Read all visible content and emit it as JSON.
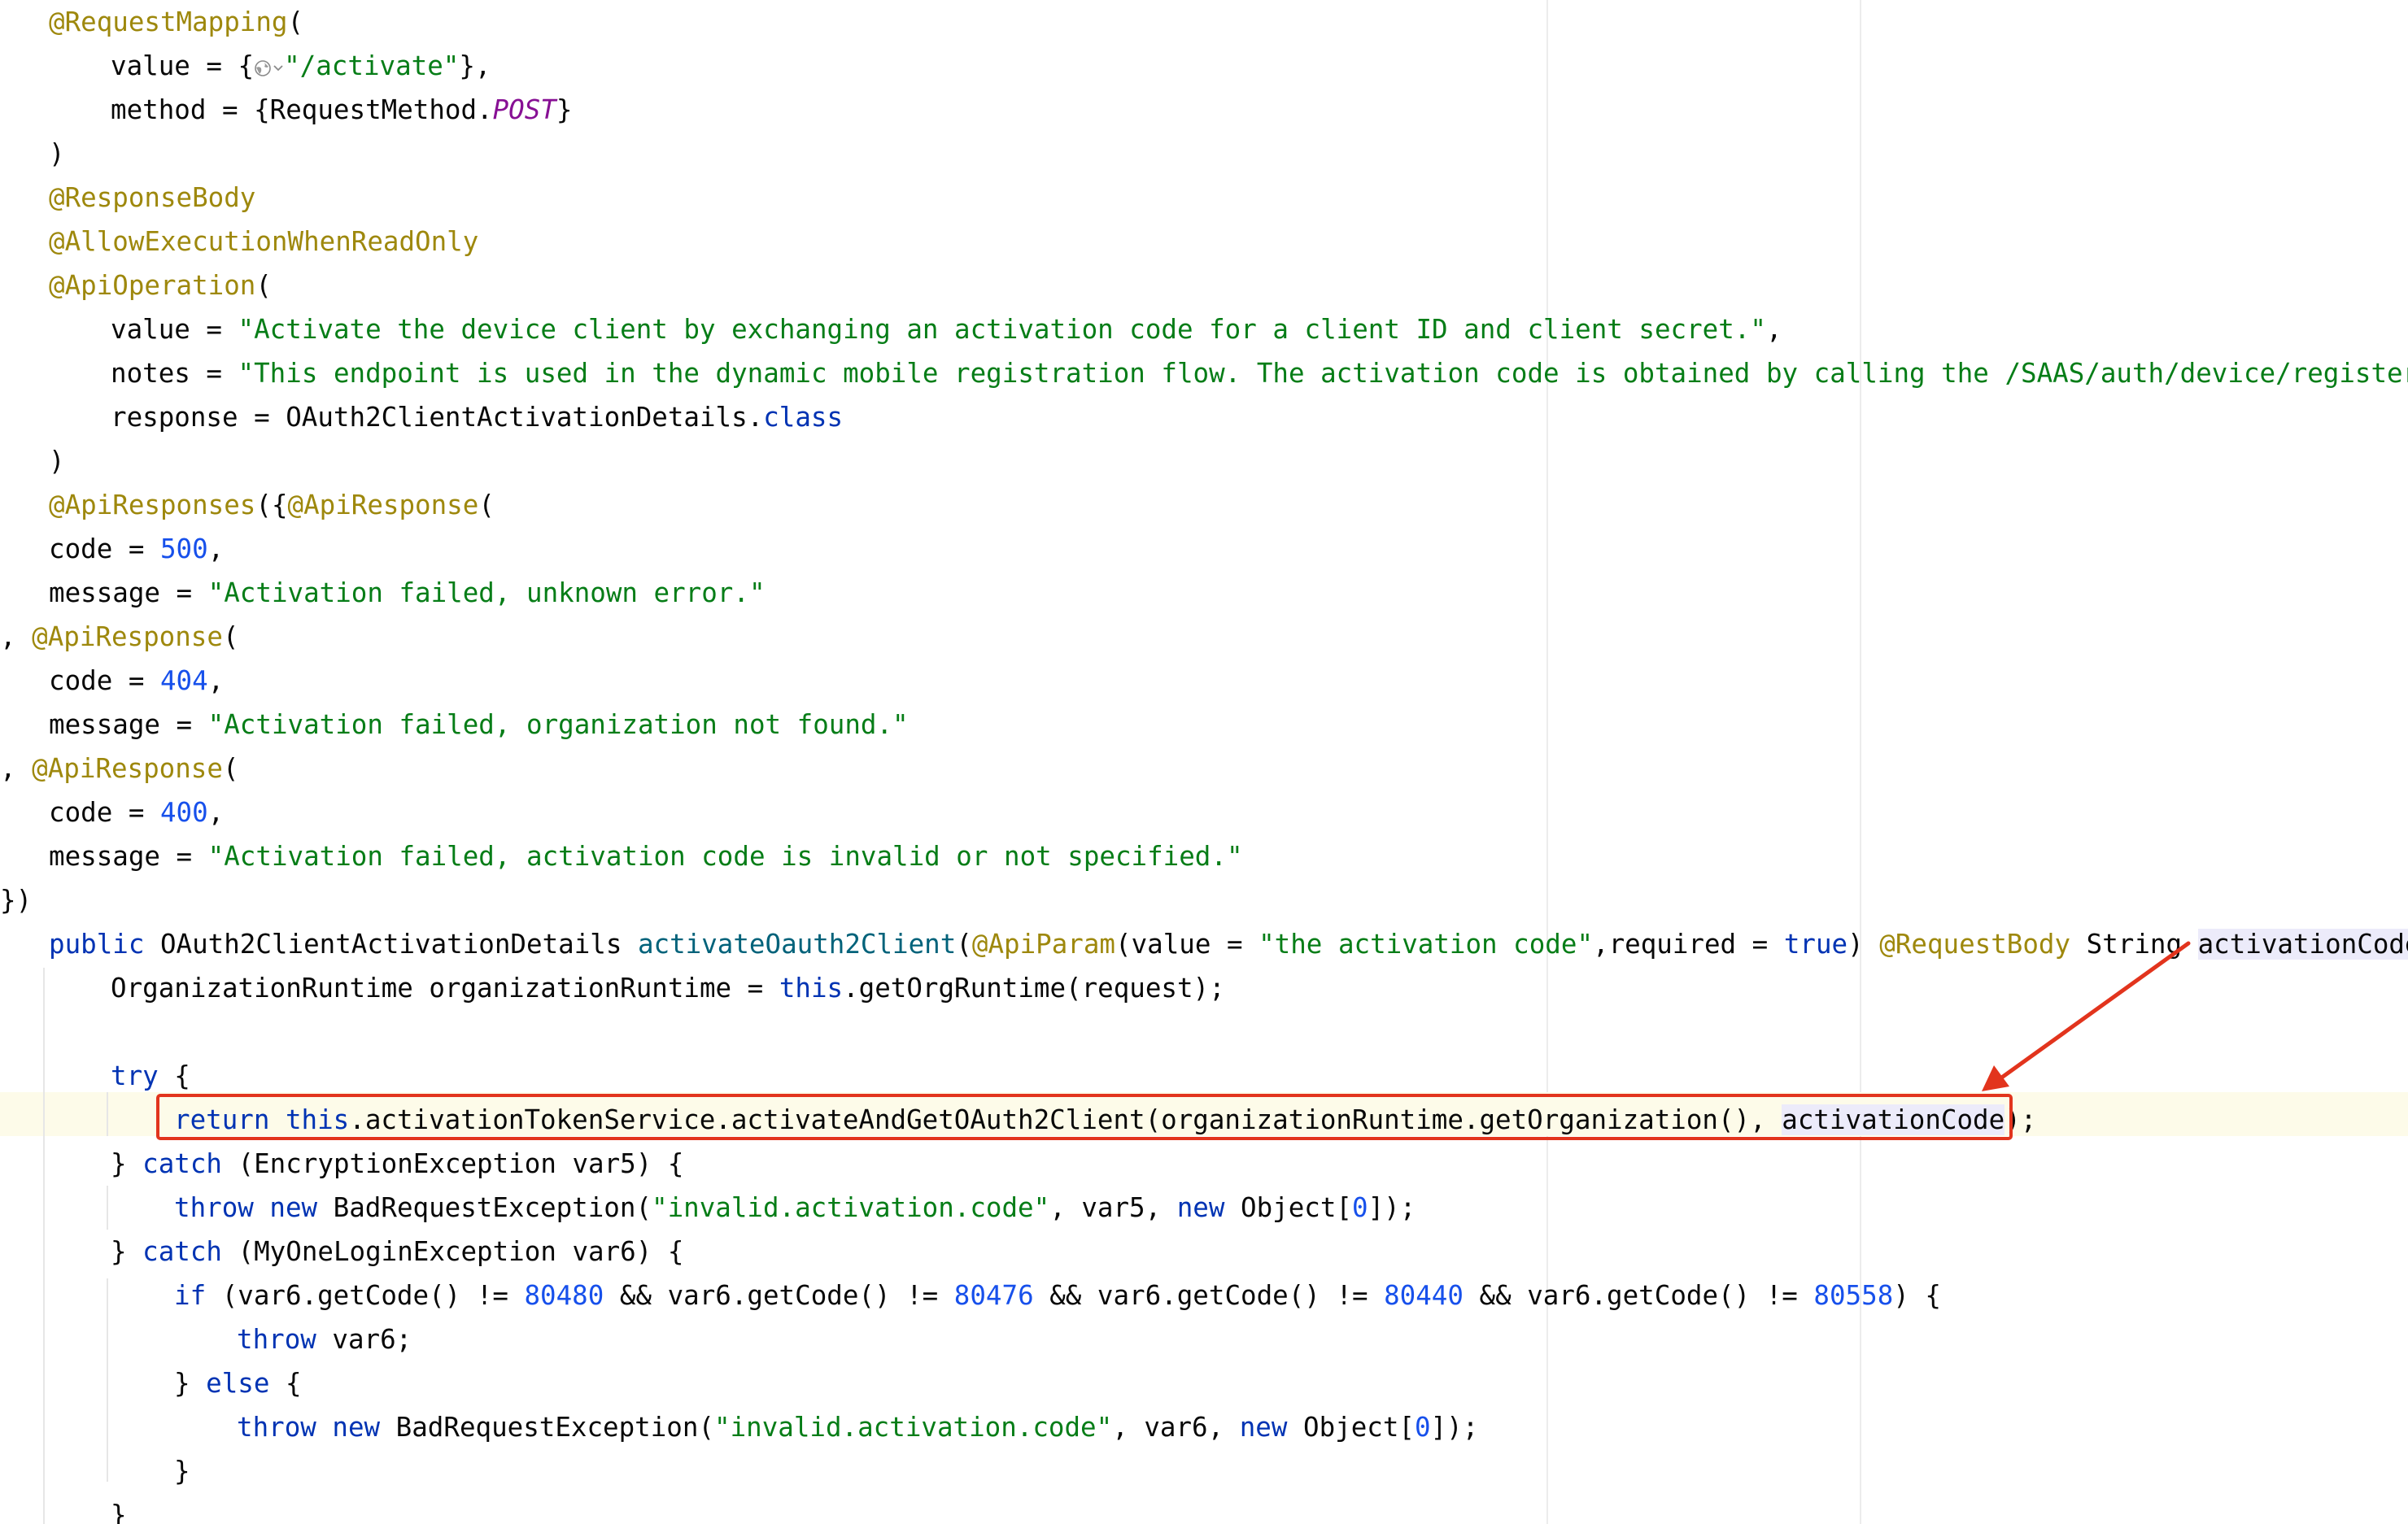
{
  "colors": {
    "annotation": "#9e880d",
    "string": "#067d17",
    "keyword": "#0033b3",
    "number": "#1750eb",
    "constant": "#871094",
    "method_declaration": "#00627a",
    "plain": "#080808",
    "highlight_box": "#e2341d",
    "arrow": "#e2341d",
    "identifier_usage_background": "#ecebfa",
    "current_line_background": "#fdfbe9"
  },
  "icons": {
    "url_globe": "globe-icon",
    "url_chevron": "chevron-down-icon"
  },
  "editor": {
    "lines": [
      [
        {
          "t": "@RequestMapping",
          "c": "ann"
        },
        {
          "t": "(",
          "c": "pl"
        }
      ],
      [
        {
          "t": "value = {",
          "c": "pl"
        },
        {
          "icon": "globe"
        },
        {
          "t": "\"/activate\"",
          "c": "str"
        },
        {
          "t": "},",
          "c": "pl"
        }
      ],
      [
        {
          "t": "method = {RequestMethod.",
          "c": "pl"
        },
        {
          "t": "POST",
          "c": "con"
        },
        {
          "t": "}",
          "c": "pl"
        }
      ],
      [
        {
          "t": ")",
          "c": "pl"
        }
      ],
      [
        {
          "t": "@ResponseBody",
          "c": "ann"
        }
      ],
      [
        {
          "t": "@AllowExecutionWhenReadOnly",
          "c": "ann"
        }
      ],
      [
        {
          "t": "@ApiOperation",
          "c": "ann"
        },
        {
          "t": "(",
          "c": "pl"
        }
      ],
      [
        {
          "t": "value = ",
          "c": "pl"
        },
        {
          "t": "\"Activate the device client by exchanging an activation code for a client ID and client secret.\"",
          "c": "str"
        },
        {
          "t": ",",
          "c": "pl"
        }
      ],
      [
        {
          "t": "notes = ",
          "c": "pl"
        },
        {
          "t": "\"This endpoint is used in the dynamic mobile registration flow. The activation code is obtained by calling the /SAAS/auth/device/register e",
          "c": "str"
        }
      ],
      [
        {
          "t": "response = OAuth2ClientActivationDetails.",
          "c": "pl"
        },
        {
          "t": "class",
          "c": "kw"
        }
      ],
      [
        {
          "t": ")",
          "c": "pl"
        }
      ],
      [
        {
          "t": "@ApiResponses",
          "c": "ann"
        },
        {
          "t": "({",
          "c": "pl"
        },
        {
          "t": "@ApiResponse",
          "c": "ann"
        },
        {
          "t": "(",
          "c": "pl"
        }
      ],
      [
        {
          "t": "code = ",
          "c": "pl"
        },
        {
          "t": "500",
          "c": "num"
        },
        {
          "t": ",",
          "c": "pl"
        }
      ],
      [
        {
          "t": "message = ",
          "c": "pl"
        },
        {
          "t": "\"Activation failed, unknown error.\"",
          "c": "str"
        }
      ],
      [
        {
          "t": ", ",
          "c": "pl"
        },
        {
          "t": "@ApiResponse",
          "c": "ann"
        },
        {
          "t": "(",
          "c": "pl"
        }
      ],
      [
        {
          "t": "code = ",
          "c": "pl"
        },
        {
          "t": "404",
          "c": "num"
        },
        {
          "t": ",",
          "c": "pl"
        }
      ],
      [
        {
          "t": "message = ",
          "c": "pl"
        },
        {
          "t": "\"Activation failed, organization not found.\"",
          "c": "str"
        }
      ],
      [
        {
          "t": ", ",
          "c": "pl"
        },
        {
          "t": "@ApiResponse",
          "c": "ann"
        },
        {
          "t": "(",
          "c": "pl"
        }
      ],
      [
        {
          "t": "code = ",
          "c": "pl"
        },
        {
          "t": "400",
          "c": "num"
        },
        {
          "t": ",",
          "c": "pl"
        }
      ],
      [
        {
          "t": "message = ",
          "c": "pl"
        },
        {
          "t": "\"Activation failed, activation code is invalid or not specified.\"",
          "c": "str"
        }
      ],
      [
        {
          "t": "})",
          "c": "pl"
        }
      ],
      [
        {
          "t": "public ",
          "c": "kw"
        },
        {
          "t": "OAuth2ClientActivationDetails ",
          "c": "pl"
        },
        {
          "t": "activateOauth2Client",
          "c": "mth"
        },
        {
          "t": "(",
          "c": "pl"
        },
        {
          "t": "@ApiParam",
          "c": "ann"
        },
        {
          "t": "(value = ",
          "c": "pl"
        },
        {
          "t": "\"the activation code\"",
          "c": "str"
        },
        {
          "t": ",required = ",
          "c": "pl"
        },
        {
          "t": "true",
          "c": "kw"
        },
        {
          "t": ") ",
          "c": "pl"
        },
        {
          "t": "@RequestBody ",
          "c": "ann"
        },
        {
          "t": "String ",
          "c": "pl"
        },
        {
          "t": "activationCode",
          "c": "pl",
          "ref": true
        },
        {
          "t": ",",
          "c": "pl"
        }
      ],
      [
        {
          "t": "OrganizationRuntime organizationRuntime = ",
          "c": "pl"
        },
        {
          "t": "this",
          "c": "kw"
        },
        {
          "t": ".getOrgRuntime(request);",
          "c": "pl"
        }
      ],
      [],
      [
        {
          "t": "try ",
          "c": "kw"
        },
        {
          "t": "{",
          "c": "pl"
        }
      ],
      [
        {
          "t": "return ",
          "c": "kw"
        },
        {
          "t": "this",
          "c": "kw"
        },
        {
          "t": ".activationTokenService.activateAndGetOAuth2Client(organizationRuntime.getOrganization(), ",
          "c": "pl"
        },
        {
          "t": "activationCode",
          "c": "pl",
          "ref": true
        },
        {
          "t": ");",
          "c": "pl"
        }
      ],
      [
        {
          "t": "} ",
          "c": "pl"
        },
        {
          "t": "catch ",
          "c": "kw"
        },
        {
          "t": "(EncryptionException var5) {",
          "c": "pl"
        }
      ],
      [
        {
          "t": "throw new ",
          "c": "kw"
        },
        {
          "t": "BadRequestException(",
          "c": "pl"
        },
        {
          "t": "\"invalid.activation.code\"",
          "c": "str"
        },
        {
          "t": ", var5, ",
          "c": "pl"
        },
        {
          "t": "new ",
          "c": "kw"
        },
        {
          "t": "Object[",
          "c": "pl"
        },
        {
          "t": "0",
          "c": "num"
        },
        {
          "t": "]);",
          "c": "pl"
        }
      ],
      [
        {
          "t": "} ",
          "c": "pl"
        },
        {
          "t": "catch ",
          "c": "kw"
        },
        {
          "t": "(MyOneLoginException var6) {",
          "c": "pl"
        }
      ],
      [
        {
          "t": "if ",
          "c": "kw"
        },
        {
          "t": "(var6.getCode() != ",
          "c": "pl"
        },
        {
          "t": "80480",
          "c": "num"
        },
        {
          "t": " && var6.getCode() != ",
          "c": "pl"
        },
        {
          "t": "80476",
          "c": "num"
        },
        {
          "t": " && var6.getCode() != ",
          "c": "pl"
        },
        {
          "t": "80440",
          "c": "num"
        },
        {
          "t": " && var6.getCode() != ",
          "c": "pl"
        },
        {
          "t": "80558",
          "c": "num"
        },
        {
          "t": ") {",
          "c": "pl"
        }
      ],
      [
        {
          "t": "throw ",
          "c": "kw"
        },
        {
          "t": "var6;",
          "c": "pl"
        }
      ],
      [
        {
          "t": "} ",
          "c": "pl"
        },
        {
          "t": "else ",
          "c": "kw"
        },
        {
          "t": "{",
          "c": "pl"
        }
      ],
      [
        {
          "t": "throw new ",
          "c": "kw"
        },
        {
          "t": "BadRequestException(",
          "c": "pl"
        },
        {
          "t": "\"invalid.activation.code\"",
          "c": "str"
        },
        {
          "t": ", var6, ",
          "c": "pl"
        },
        {
          "t": "new ",
          "c": "kw"
        },
        {
          "t": "Object[",
          "c": "pl"
        },
        {
          "t": "0",
          "c": "num"
        },
        {
          "t": "]);",
          "c": "pl"
        }
      ],
      [
        {
          "t": "}",
          "c": "pl"
        }
      ],
      [
        {
          "t": "}",
          "c": "pl"
        }
      ]
    ]
  }
}
